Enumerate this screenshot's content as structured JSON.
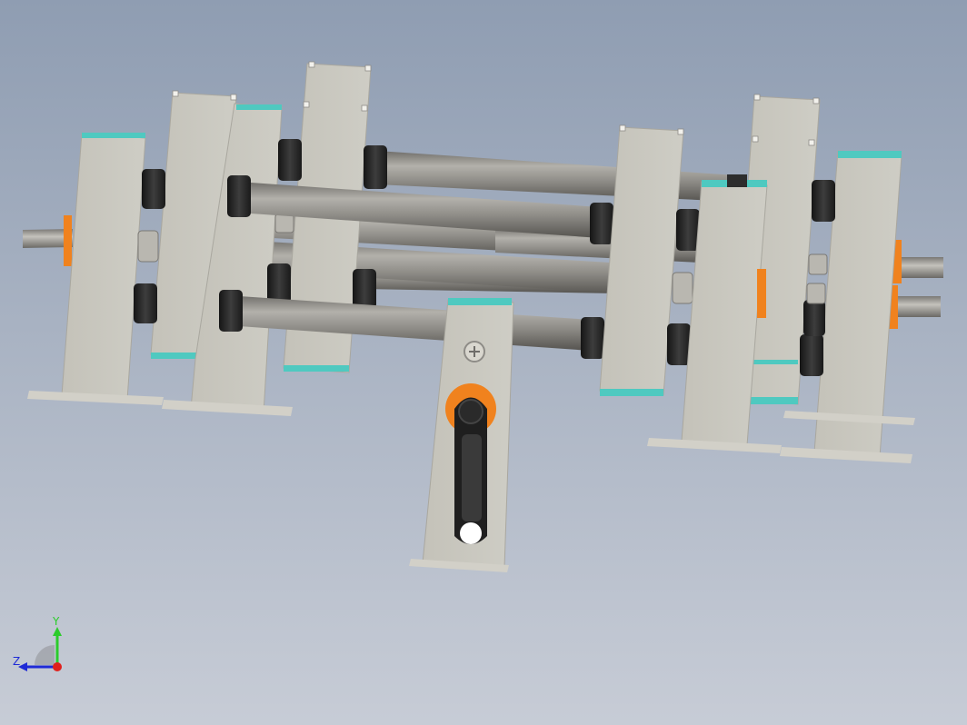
{
  "viewport": {
    "background_top": "#8f9db2",
    "background_bottom": "#c7ccd6"
  },
  "model": {
    "plate_color": "#c8c6bd",
    "rod_color": "#8d8b86",
    "roller_color": "#2d2d2d",
    "accent_cyan": "#4fc9c0",
    "accent_orange": "#f0821e",
    "crank_color": "#1f1f1f",
    "icons": [
      "handle-crank-icon",
      "screw-head-icon"
    ]
  },
  "triad": {
    "y_label": "Y",
    "z_label": "Z",
    "y_color": "#2bcc2b",
    "z_color": "#1f2bd6",
    "origin_color": "#e0201c"
  }
}
